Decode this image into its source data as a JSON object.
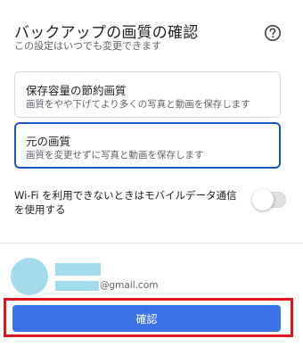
{
  "dialog": {
    "title": "バックアップの画質の確認",
    "subtitle": "この設定はいつでも変更できます",
    "help_icon": "help-circle-icon"
  },
  "options": [
    {
      "title": "保存容量の節約画質",
      "description": "画質をやや下げてより多くの写真と動画を保存します",
      "selected": false
    },
    {
      "title": "元の画質",
      "description": "画質を変更せずに写真と動画を保存します",
      "selected": true
    }
  ],
  "wifi_setting": {
    "label": "Wi-Fi を利用できないときはモバイルデータ通信を使用する",
    "enabled": false
  },
  "account": {
    "email_domain": "@gmail.com"
  },
  "actions": {
    "confirm_label": "確認"
  },
  "colors": {
    "accent": "#3a73e8",
    "selected_border": "#1a56c6",
    "highlight_frame": "#e0141e",
    "redaction": "#a3dbea"
  }
}
